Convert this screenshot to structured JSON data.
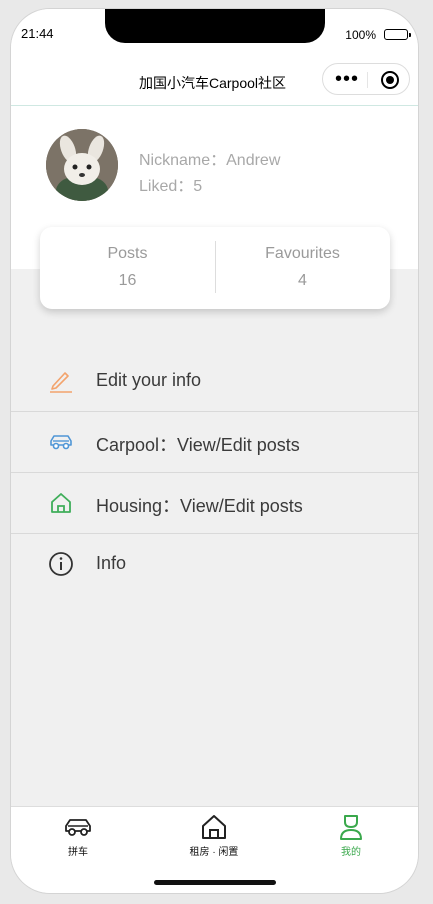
{
  "status": {
    "time": "21:44",
    "battery": "100%"
  },
  "navbar": {
    "title": "加国小汽车Carpool社区"
  },
  "profile": {
    "nickname": "Nickname：Andrew",
    "liked": "Liked：5"
  },
  "stats": [
    {
      "label": "Posts",
      "value": "16"
    },
    {
      "label": "Favourites",
      "value": "4"
    }
  ],
  "menu": [
    {
      "label": "Edit your info",
      "icon": "pencil-icon",
      "color": "#f3a36c"
    },
    {
      "label": "Carpool：View/Edit posts",
      "icon": "car-icon",
      "color": "#4f96d6"
    },
    {
      "label": "Housing：View/Edit posts",
      "icon": "house-icon",
      "color": "#3fae5a"
    },
    {
      "label": "Info",
      "icon": "info-icon",
      "color": "#333333"
    }
  ],
  "tabbar": [
    {
      "label": "拼车",
      "icon": "car-icon",
      "active": false
    },
    {
      "label": "租房 · 闲置",
      "icon": "house-icon",
      "active": false
    },
    {
      "label": "我的",
      "icon": "person-icon",
      "active": true
    }
  ],
  "colors": {
    "accent": "#3aa84c"
  }
}
